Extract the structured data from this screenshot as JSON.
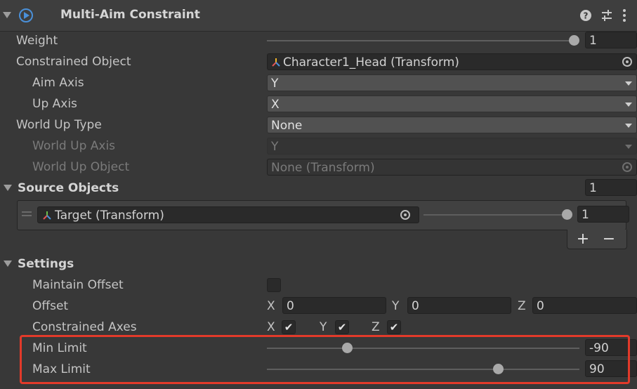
{
  "component": {
    "title": "Multi-Aim Constraint"
  },
  "fields": {
    "weight": {
      "label": "Weight",
      "value": "1",
      "level": 1
    },
    "constrained_object": {
      "label": "Constrained Object",
      "value": "Character1_Head (Transform)"
    },
    "aim_axis": {
      "label": "Aim Axis",
      "value": "Y"
    },
    "up_axis": {
      "label": "Up Axis",
      "value": "X"
    },
    "world_up_type": {
      "label": "World Up Type",
      "value": "None"
    },
    "world_up_axis": {
      "label": "World Up Axis",
      "value": "Y"
    },
    "world_up_object": {
      "label": "World Up Object",
      "value": "None (Transform)"
    }
  },
  "source_objects": {
    "label": "Source Objects",
    "count": "1",
    "items": [
      {
        "value": "Target (Transform)",
        "weight": "1",
        "level": 1
      }
    ],
    "add_label": "+",
    "remove_label": "−"
  },
  "settings": {
    "label": "Settings",
    "maintain_offset": {
      "label": "Maintain Offset",
      "checked": false
    },
    "offset": {
      "label": "Offset",
      "x_label": "X",
      "x": "0",
      "y_label": "Y",
      "y": "0",
      "z_label": "Z",
      "z": "0"
    },
    "constrained_axes": {
      "label": "Constrained Axes",
      "x_label": "X",
      "y_label": "Y",
      "z_label": "Z",
      "x": true,
      "y": true,
      "z": true
    },
    "min_limit": {
      "label": "Min Limit",
      "value": "-90",
      "range": [
        -180,
        180
      ]
    },
    "max_limit": {
      "label": "Max Limit",
      "value": "90",
      "range": [
        -180,
        180
      ]
    }
  },
  "colors": {
    "highlight_box": "#e23a2a",
    "background": "#383838"
  },
  "icons": [
    "foldout-arrow-icon",
    "constraint-component-icon",
    "help-icon",
    "preset-sliders-icon",
    "kebab-menu-icon",
    "transform-icon",
    "object-picker-icon",
    "drag-handle-icon",
    "checkmark-icon"
  ]
}
